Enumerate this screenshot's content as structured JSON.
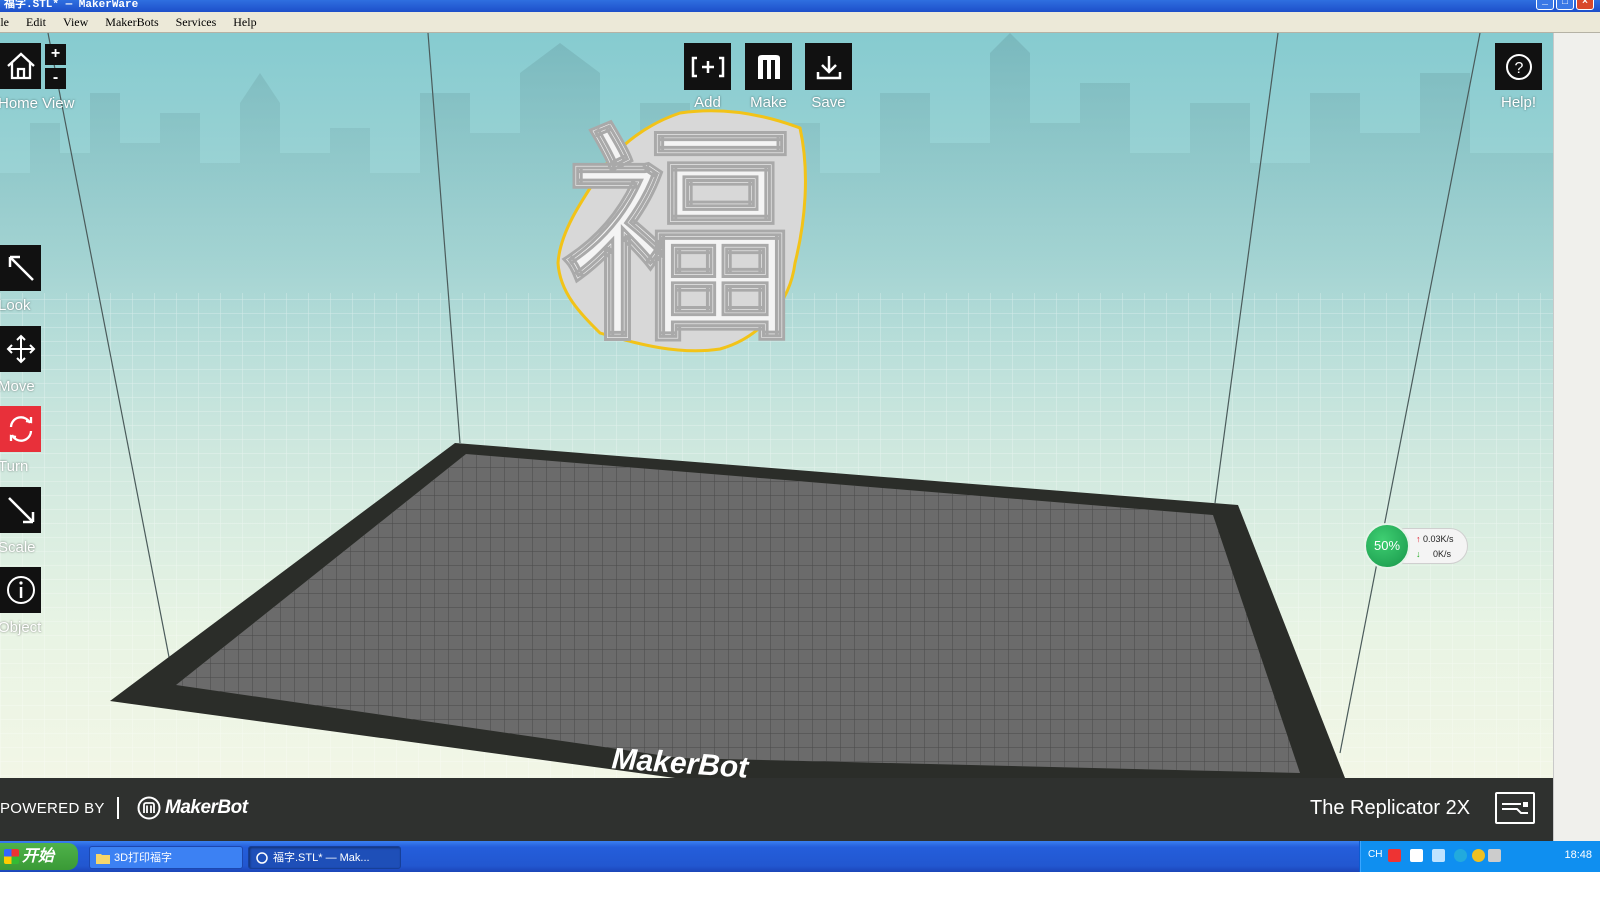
{
  "window": {
    "title": "福字.STL* — MakerWare",
    "buttons": [
      "minimize",
      "maximize",
      "close"
    ]
  },
  "menu": {
    "items": [
      "ile",
      "Edit",
      "View",
      "MakerBots",
      "Services",
      "Help"
    ]
  },
  "top_toolbar": {
    "add_label": "Add",
    "make_label": "Make",
    "save_label": "Save",
    "help_label": "Help!"
  },
  "side_toolbar": {
    "home_view_label": "Home View",
    "zoom_in": "+",
    "zoom_out": "-",
    "look_label": "Look",
    "move_label": "Move",
    "turn_label": "Turn",
    "scale_label": "Scale",
    "object_label": "Object"
  },
  "scene": {
    "platform_brand": "MakerBot",
    "model_character": "福",
    "colors": {
      "selection_outline": "#f2c318",
      "platform": "#6b6b6b",
      "platform_border": "#2b2d29",
      "turn_active": "#e8303a"
    }
  },
  "bottom_bar": {
    "powered_by": "POWERED BY",
    "brand": "MakerBot",
    "printer": "The Replicator 2X"
  },
  "net_widget": {
    "percent": "50%",
    "upload": "0.03K/s",
    "download": "0K/s"
  },
  "taskbar": {
    "start_label": "开始",
    "tasks": [
      "3D打印福字",
      "福字.STL* — Mak..."
    ],
    "tray_lang": "CH",
    "clock": "18:48"
  }
}
